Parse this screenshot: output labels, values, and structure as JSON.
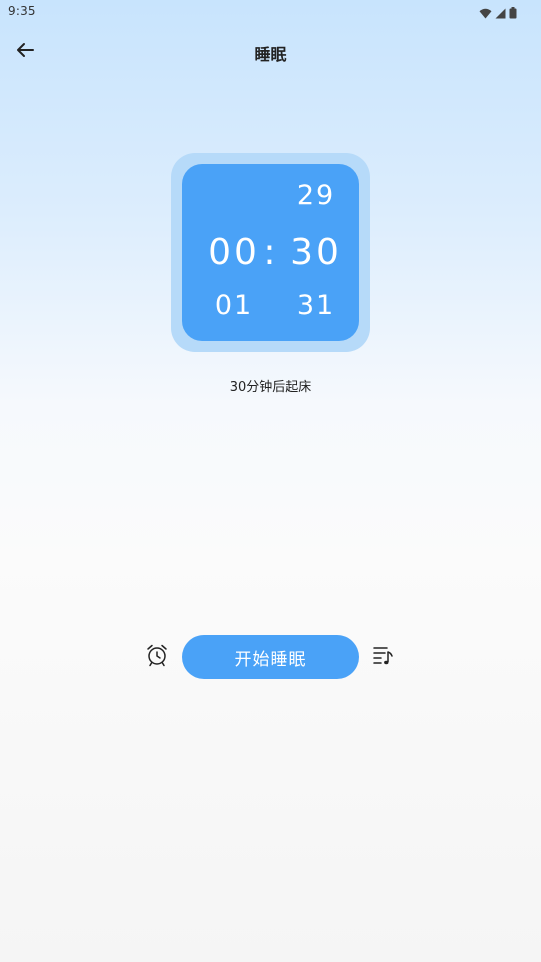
{
  "status_bar": {
    "time": "9:35",
    "icons": [
      "wifi-icon",
      "cellular-signal-icon",
      "battery-icon"
    ]
  },
  "header": {
    "title": "睡眠",
    "back_icon": "arrow-left-icon"
  },
  "time_picker": {
    "hours": {
      "above": "",
      "selected": "00",
      "below": "01"
    },
    "separator": ":",
    "minutes": {
      "above": "29",
      "selected": "30",
      "below": "31"
    }
  },
  "wake_caption": "30分钟后起床",
  "controls": {
    "alarm_icon": "alarm-clock-icon",
    "start_label": "开始睡眠",
    "music_icon": "music-playlist-icon"
  },
  "colors": {
    "accent": "#4aa2f7",
    "clock_frame": "#b6daf9",
    "background_top": "#c8e4fd",
    "background_bottom": "#f5f5f5"
  }
}
